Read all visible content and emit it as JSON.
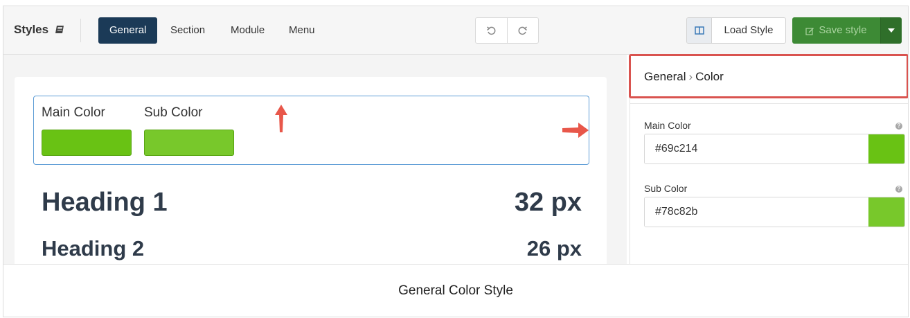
{
  "toolbar": {
    "brand": "Styles",
    "tabs": [
      {
        "label": "General",
        "active": true
      },
      {
        "label": "Section",
        "active": false
      },
      {
        "label": "Module",
        "active": false
      },
      {
        "label": "Menu",
        "active": false
      }
    ],
    "load_style_label": "Load Style",
    "save_style_label": "Save style"
  },
  "preview": {
    "main_color_label": "Main Color",
    "sub_color_label": "Sub Color",
    "headings": [
      {
        "text": "Heading 1",
        "size": "32 px"
      },
      {
        "text": "Heading 2",
        "size": "26 px"
      }
    ]
  },
  "panel": {
    "breadcrumb_parent": "General",
    "breadcrumb_separator": "›",
    "breadcrumb_current": "Color",
    "main_color": {
      "label": "Main Color",
      "value": "#69c214"
    },
    "sub_color": {
      "label": "Sub Color",
      "value": "#78c82b"
    }
  },
  "caption": "General Color Style",
  "colors": {
    "main": "#69c214",
    "sub": "#78c82b",
    "active_tab": "#1b3a57",
    "save_button": "#3d8a35",
    "highlight": "#d9534f",
    "arrow": "#e8574a"
  }
}
